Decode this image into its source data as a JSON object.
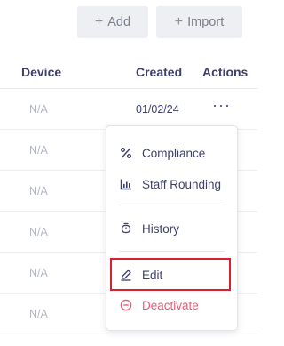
{
  "toolbar": {
    "add_label": "Add",
    "import_label": "Import",
    "plus_glyph": "+"
  },
  "table": {
    "columns": [
      "Device",
      "Created",
      "Actions"
    ],
    "rows": [
      {
        "device": "N/A",
        "created": "01/02/24",
        "actions": "···"
      },
      {
        "device": "N/A"
      },
      {
        "device": "N/A"
      },
      {
        "device": "N/A"
      },
      {
        "device": "N/A"
      },
      {
        "device": "N/A"
      }
    ]
  },
  "menu": {
    "items": [
      {
        "label": "Compliance",
        "icon": "percent-icon"
      },
      {
        "label": "Staff Rounding",
        "icon": "bar-chart-icon"
      },
      {
        "label": "History",
        "icon": "history-icon"
      },
      {
        "label": "Edit",
        "icon": "pencil-icon"
      },
      {
        "label": "Deactivate",
        "icon": "minus-circle-icon"
      }
    ]
  },
  "colors": {
    "accent": "#3d3f6a",
    "danger": "#e0607a",
    "highlight": "#d9202f"
  }
}
